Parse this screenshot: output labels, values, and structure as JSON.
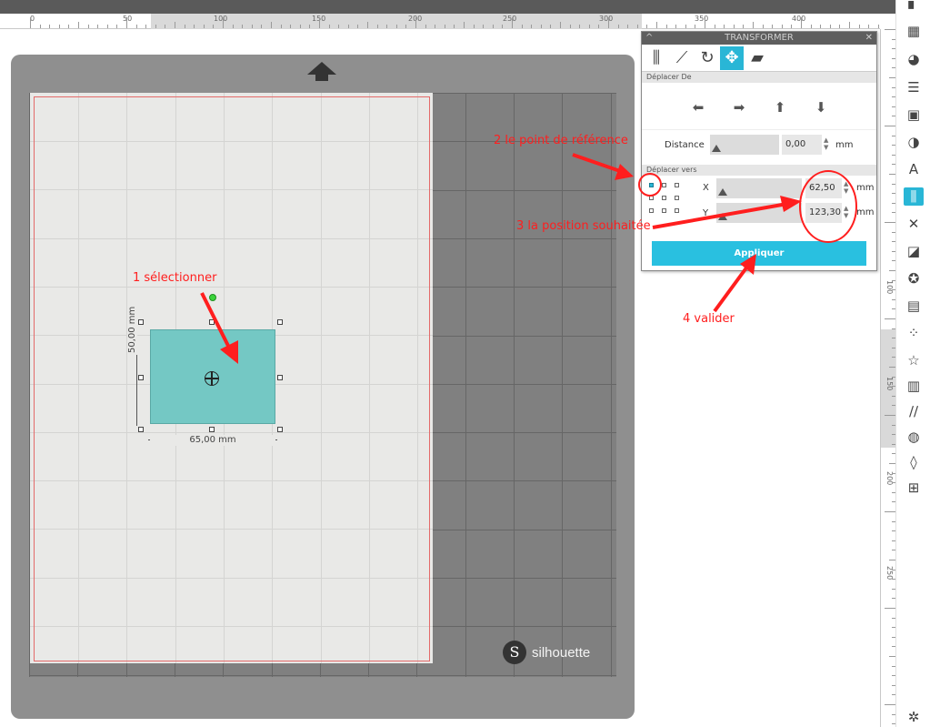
{
  "ruler": {
    "top_labels": [
      "0",
      "50",
      "100",
      "150",
      "200",
      "250",
      "300",
      "350",
      "400"
    ],
    "right_labels": [
      "100",
      "150",
      "200",
      "250"
    ]
  },
  "panel": {
    "title": "TRANSFORMER",
    "tabs": [
      "align-icon",
      "scale-icon",
      "rotate-icon",
      "move-icon",
      "shear-icon"
    ],
    "section_move_by": "Déplacer De",
    "distance_label": "Distance",
    "distance_value": "0,00",
    "distance_unit": "mm",
    "section_move_to": "Déplacer vers",
    "x_label": "X",
    "x_value": "62,50",
    "x_unit": "mm",
    "y_label": "Y",
    "y_value": "123,30",
    "y_unit": "mm",
    "apply_label": "Appliquer"
  },
  "shape": {
    "width_label": "65,00 mm",
    "height_label": "50,00 mm",
    "fill": "#74c8c4"
  },
  "logo": {
    "word": "silhouette"
  },
  "annotations": {
    "step1": "1 sélectionner",
    "step2": "2 le point de référence",
    "step3": "3 la position souhaitée",
    "step4": "4 valider"
  },
  "colors": {
    "accent": "#29b6d6",
    "annotation": "#ff1e1e",
    "mat": "#8f8f8f"
  }
}
